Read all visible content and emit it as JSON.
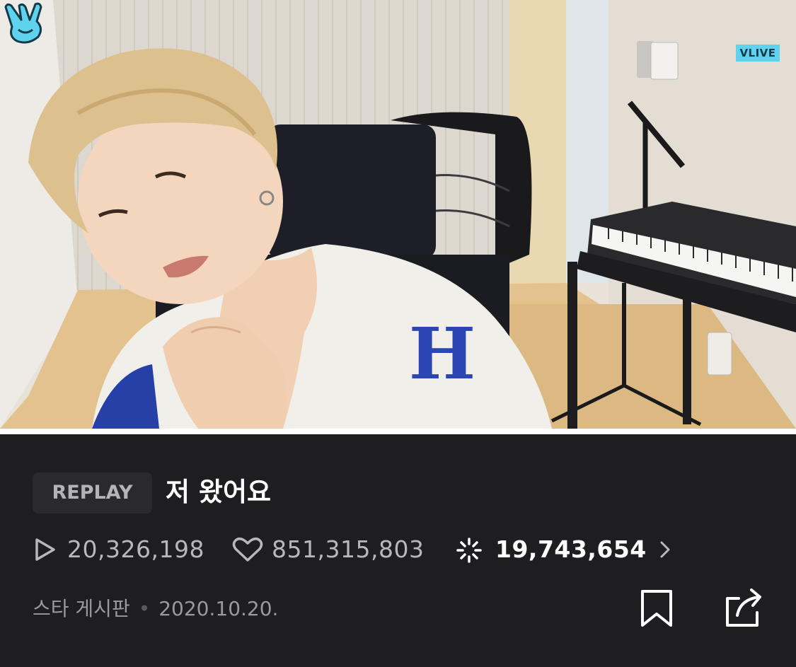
{
  "video": {
    "logo_label": "VLIVE",
    "logo_icon": "v-hand-icon",
    "progress": 1.0
  },
  "badge": {
    "label": "REPLAY"
  },
  "title": "저 왔어요",
  "stats": {
    "plays": "20,326,198",
    "likes": "851,315,803",
    "comments": "19,743,654"
  },
  "meta": {
    "channel": "스타 게시판",
    "separator": "•",
    "date": "2020.10.20."
  },
  "colors": {
    "background": "#1e1e21",
    "accent": "#5fd3ee",
    "badge_bg": "#2a2a2d"
  }
}
